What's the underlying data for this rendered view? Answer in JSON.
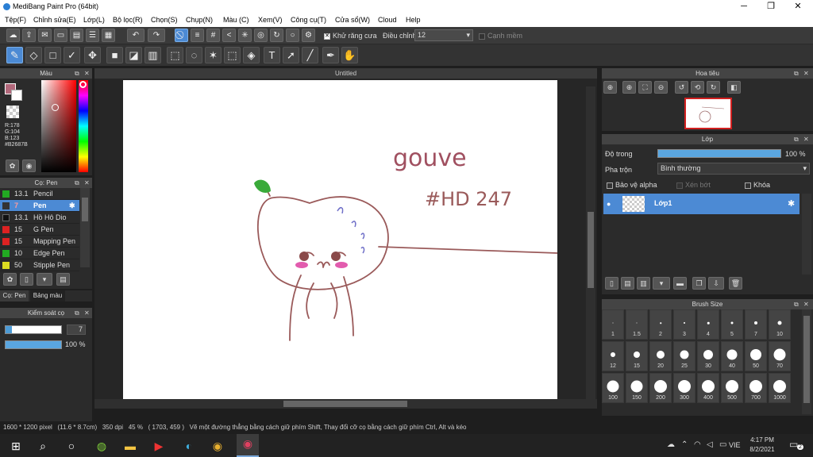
{
  "title": "MediBang Paint Pro (64bit)",
  "menu": [
    "Tệp(F)",
    "Chỉnh sửa(E)",
    "Lớp(L)",
    "Bộ lọc(R)",
    "Chọn(S)",
    "Chụp(N)",
    "Màu (C)",
    "Xem(V)",
    "Công cụ(T)",
    "Cửa sổ(W)",
    "Cloud",
    "Help"
  ],
  "toolbar1": {
    "antialias_label": "Khử răng cưa",
    "adjust_label": "Điều chỉnh",
    "adjust_value": "12",
    "smooth_label": "Cạnh mềm"
  },
  "color_panel": {
    "title": "Màu",
    "r": "R:178",
    "g": "G:104",
    "b": "B:123",
    "hex": "#B2687B",
    "current_color": "#b2687b"
  },
  "brush_panel": {
    "title": "Cọ: Pen",
    "brushes": [
      {
        "size": "13.1",
        "name": "Pencil",
        "color": "#22aa22"
      },
      {
        "size": "7",
        "name": "Pen",
        "color": "#333333",
        "selected": true
      },
      {
        "size": "13.1",
        "name": "Hồ Hô Dio",
        "color": "#111111"
      },
      {
        "size": "15",
        "name": "G Pen",
        "color": "#dd2222"
      },
      {
        "size": "15",
        "name": "Mapping Pen",
        "color": "#dd2222"
      },
      {
        "size": "10",
        "name": "Edge Pen",
        "color": "#22aa22"
      },
      {
        "size": "50",
        "name": "Stipple Pen",
        "color": "#dddd22"
      }
    ],
    "tab1": "Cọ: Pen",
    "tab2": "Bảng màu"
  },
  "brush_control": {
    "title": "Kiểm soát cọ",
    "size": "7",
    "opacity": "100 %"
  },
  "canvas": {
    "tab": "Untitled",
    "text1": "gouve",
    "text2": "#HD 247"
  },
  "navigator": {
    "title": "Hoa tiêu"
  },
  "layer_panel": {
    "title": "Lớp",
    "opacity_label": "Độ trong",
    "opacity_value": "100 %",
    "blend_label": "Pha trộn",
    "blend_value": "Bình thường",
    "protect_alpha": "Bảo vệ alpha",
    "clip": "Xén bớt",
    "lock": "Khóa",
    "layer_name": "Lớp1"
  },
  "brush_size_panel": {
    "title": "Brush Size",
    "sizes": [
      "1",
      "1.5",
      "2",
      "3",
      "4",
      "5",
      "7",
      "10",
      "12",
      "15",
      "20",
      "25",
      "30",
      "40",
      "50",
      "70",
      "100",
      "150",
      "200",
      "300",
      "400",
      "500",
      "700",
      "1000"
    ]
  },
  "status": "1600 * 1200 pixel   (11.6 * 8.7cm)   350 dpi   45 %   ( 1703, 459 )   Vẽ một đường thẳng bằng cách giữ phím Shift, Thay đổi cỡ cọ bằng cách giữ phím Ctrl, Alt và kéo",
  "taskbar": {
    "time": "4:17 PM",
    "date": "8/2/2021",
    "lang": "VIE",
    "notif": "2"
  }
}
